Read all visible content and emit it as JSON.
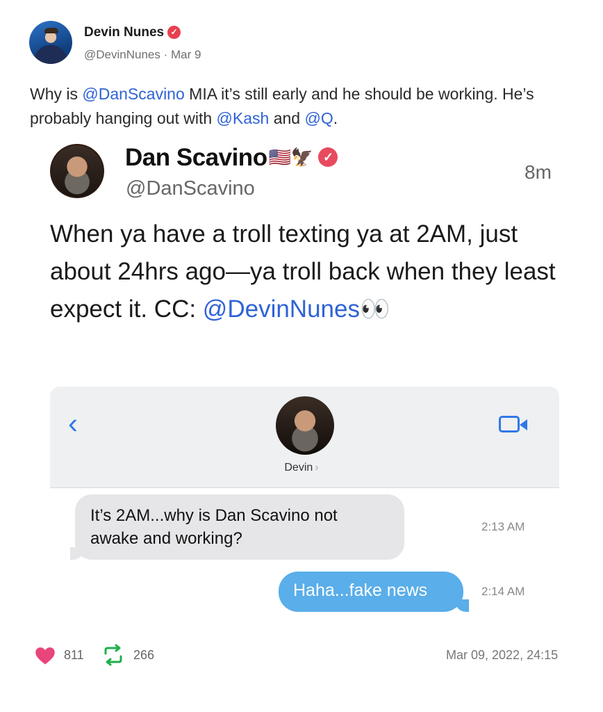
{
  "post": {
    "author_name": "Devin Nunes",
    "author_handle_date": "@DevinNunes · Mar 9",
    "text_parts": [
      "Why is ",
      "@DanScavino",
      " MIA it’s still early and he should be working. He’s probably hanging out with ",
      "@Kash",
      " and ",
      "@Q",
      "."
    ]
  },
  "quoted": {
    "name": "Dan Scavino",
    "name_emojis": "🇺🇸🦅",
    "handle": "@DanScavino",
    "time": "8m",
    "text": "When ya have a troll texting ya at 2AM, just about 24hrs ago—ya troll back when they least expect it. CC: ",
    "mention": "@DevinNunes",
    "emoji": "👀"
  },
  "imessage": {
    "back_glyph": "‹",
    "contact_name": "Devin",
    "contact_chevron": "›",
    "messages": [
      {
        "text": "It’s 2AM...why is Dan Scavino not awake and working?",
        "time": "2:13 AM",
        "direction": "incoming"
      },
      {
        "text": "Haha...fake news",
        "time": "2:14 AM",
        "direction": "outgoing"
      }
    ]
  },
  "footer": {
    "likes": "811",
    "reposts": "266",
    "timestamp": "Mar 09, 2022, 24:15"
  },
  "colors": {
    "mention": "#2f63d6",
    "verified": "#e8404f",
    "outgoing_bubble": "#5aaee9",
    "incoming_bubble": "#e6e6e9",
    "heart": "#e8457a",
    "repost": "#1fae4a"
  }
}
